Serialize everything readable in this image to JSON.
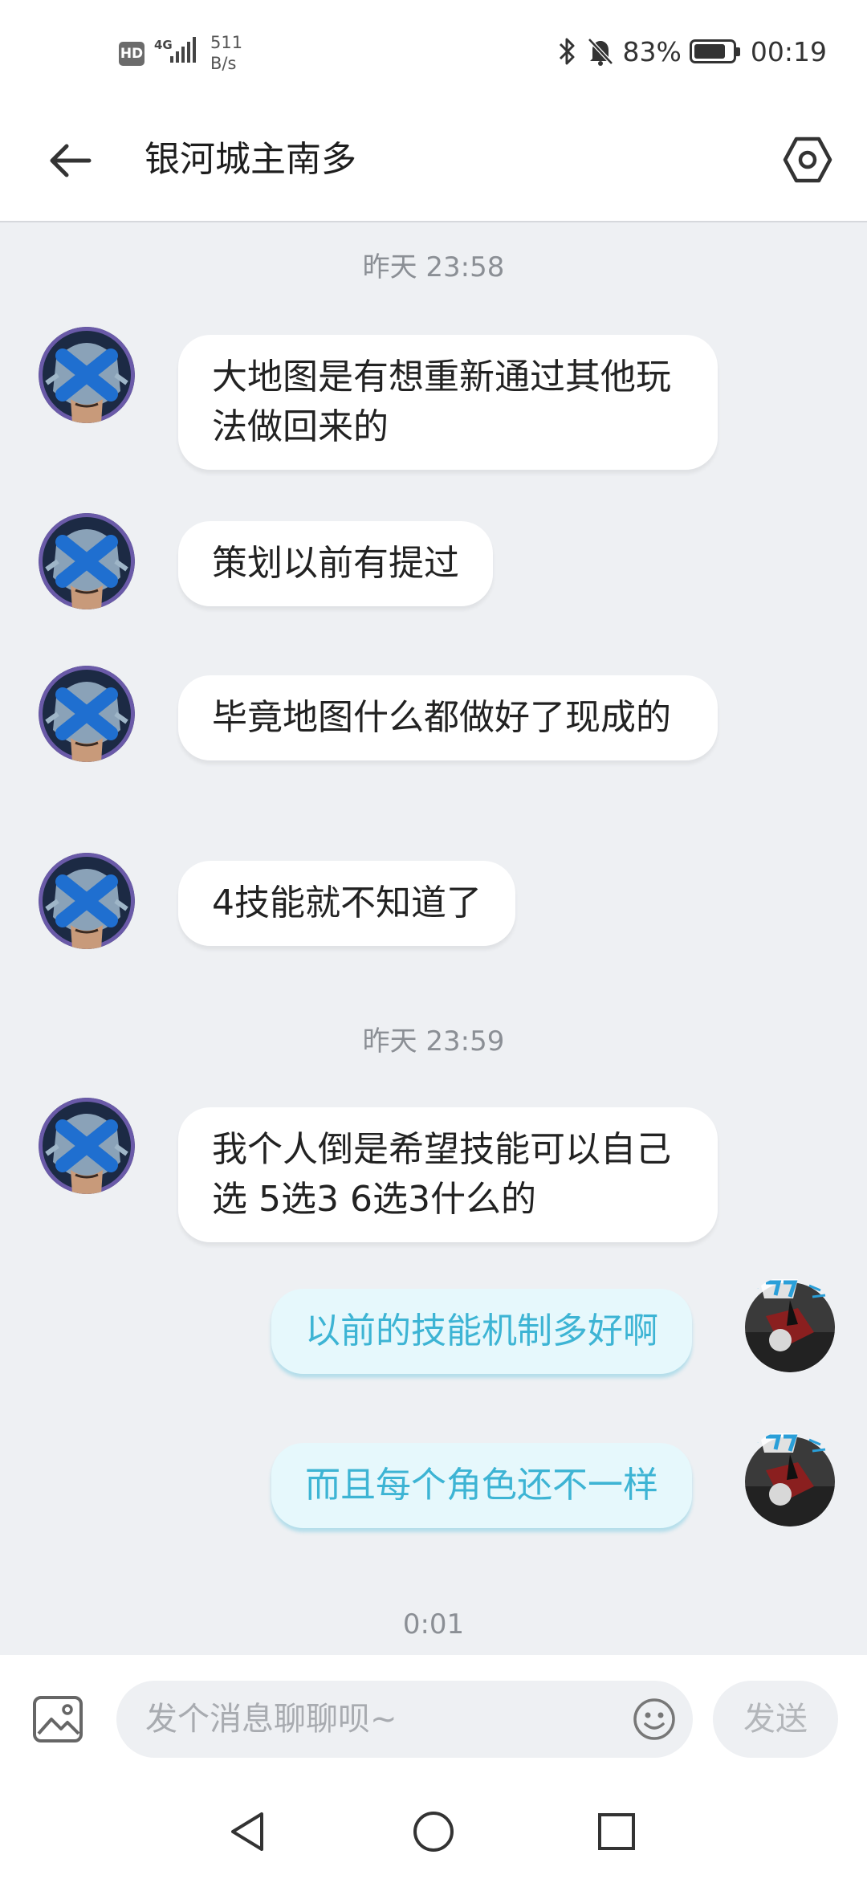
{
  "status_bar": {
    "hd": "HD",
    "network": "4G",
    "speed_value": "511",
    "speed_unit": "B/s",
    "battery": "83%",
    "battery_level": 0.83,
    "time": "00:19"
  },
  "header": {
    "title": "银河城主南多"
  },
  "messages": [
    {
      "type": "timestamp",
      "text": "昨天 23:58"
    },
    {
      "type": "received",
      "text": "大地图是有想重新通过其他玩法做回来的"
    },
    {
      "type": "received",
      "text": "策划以前有提过"
    },
    {
      "type": "received",
      "text": "毕竟地图什么都做好了现成的"
    },
    {
      "type": "received",
      "text": "4技能就不知道了"
    },
    {
      "type": "timestamp",
      "text": "昨天 23:59"
    },
    {
      "type": "received",
      "text": "我个人倒是希望技能可以自己选 5选3 6选3什么的"
    },
    {
      "type": "sent",
      "text": "以前的技能机制多好啊"
    },
    {
      "type": "sent",
      "text": "而且每个角色还不一样"
    },
    {
      "type": "timestamp",
      "text": "0:01"
    }
  ],
  "input_bar": {
    "placeholder": "发个消息聊聊呗~",
    "value": "",
    "send_label": "发送"
  },
  "colors": {
    "sent_text": "#3db4d4",
    "sent_bubble": "#e6f8fc",
    "background": "#eef0f3"
  }
}
